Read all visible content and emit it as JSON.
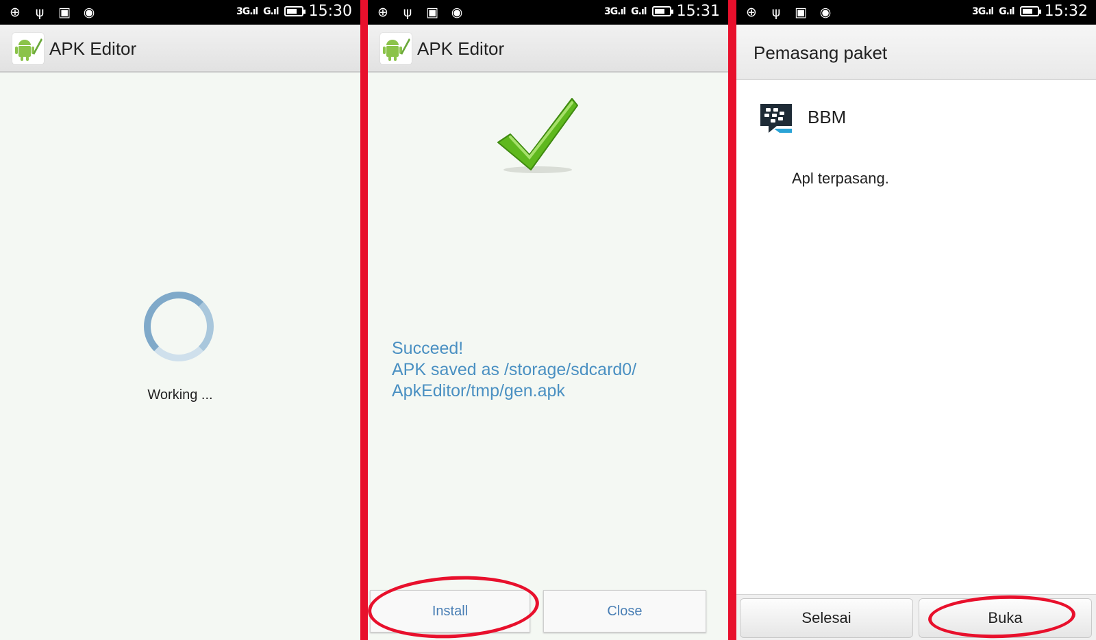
{
  "screens": [
    {
      "status": {
        "time": "15:30",
        "signal1": "3G.ıl",
        "signal2": "G.ıl"
      },
      "app_title": "APK Editor",
      "progress_text": "Working ..."
    },
    {
      "status": {
        "time": "15:31",
        "signal1": "3G.ıl",
        "signal2": "G.ıl"
      },
      "app_title": "APK Editor",
      "message_lines": [
        "Succeed!",
        "APK saved as /storage/sdcard0/",
        "ApkEditor/tmp/gen.apk"
      ],
      "install_label": "Install",
      "close_label": "Close"
    },
    {
      "status": {
        "time": "15:32",
        "signal1": "3G.ıl",
        "signal2": "G.ıl"
      },
      "title": "Pemasang paket",
      "app_name": "BBM",
      "installed_text": "Apl terpasang.",
      "done_label": "Selesai",
      "open_label": "Buka"
    }
  ],
  "icons": [
    "usb-debug-icon",
    "usb-icon",
    "gallery-icon",
    "shield-app-icon",
    "battery-icon",
    "app-android-icon",
    "checkmark-icon",
    "bbm-icon"
  ],
  "colors": {
    "frame_red": "#e8102c",
    "link_blue": "#4a90c2",
    "check_green": "#5fb81e",
    "spinner_blue": "#7fa9c9"
  }
}
